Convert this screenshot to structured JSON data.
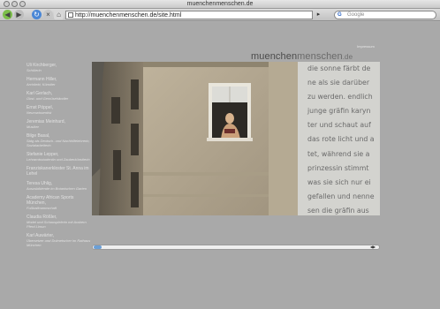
{
  "window": {
    "title": "muenchenmenschen.de"
  },
  "toolbar": {
    "url": "http://muenchenmenschen.de/site.html",
    "search_placeholder": "Google",
    "go_label": "▸"
  },
  "site": {
    "impressum": "Impressum",
    "brand_part1": "muenchen",
    "brand_part2": "menschen",
    "brand_part3": ".de"
  },
  "sidebar": {
    "items": [
      {
        "name": "Uli Kirchberger,",
        "sub": "Schülerin"
      },
      {
        "name": "Hermann Hiller,",
        "sub": "Architekt, Künstler"
      },
      {
        "name": "Karl Gerlach,",
        "sub": "Obst- und Gemüsehändler"
      },
      {
        "name": "Ernst Pöppel,",
        "sub": "Neurowissentist"
      },
      {
        "name": "Jeremias Meinhard,",
        "sub": "Musiker"
      },
      {
        "name": "Bilge Basal,",
        "sub": "Stdg als Deutsch- und Nachhilfelehrerin, Sozialarbeiterin"
      },
      {
        "name": "Stefanie Lepper,",
        "sub": "Lehramtsstudentin und Zauberkünstlerin"
      },
      {
        "name": "Franziskanerkloster St. Anna im Lehel",
        "sub": ""
      },
      {
        "name": "Teresa Uhlig,",
        "sub": "Auszubildende im Botanischen Garten"
      },
      {
        "name": "Academy African Sports München,",
        "sub": "Fußballmannschaft"
      },
      {
        "name": "Claudia Rößler,",
        "sub": "Model und Schauspielerin mit Arabern Pferd Limun"
      },
      {
        "name": "Karl Auwärter,",
        "sub": "Übersetzer und Dolmetscher im Rathaus München"
      }
    ]
  },
  "text_panel": {
    "lines": [
      "die sonne färbt de",
      "ne als sie darüber",
      "zu werden. endlich",
      "junge gräfin karyn",
      "ter und schaut auf",
      "das rote licht und a",
      "tet, während sie a",
      "prinzessin stimmt",
      "was sie sich nur ei",
      "gefallen und nenne",
      "sen die gräfin aus"
    ]
  },
  "scrollbar": {
    "left_arrow": "◀",
    "right_arrow": "▶"
  }
}
